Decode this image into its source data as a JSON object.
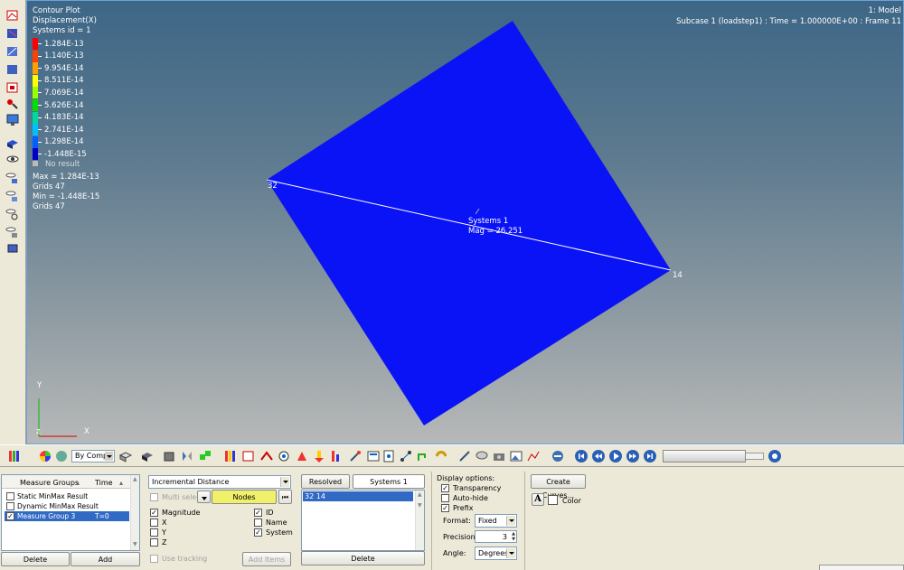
{
  "viewport": {
    "plot_title": "Contour Plot",
    "plot_result": "Displacement(X)",
    "plot_system": "Systems id = 1",
    "model_label": "1: Model",
    "subcase_label": "Subcase 1 (loadstep1) : Time = 1.000000E+00 : Frame 11",
    "legend": [
      {
        "value": "1.284E-13",
        "color": "#ff0000"
      },
      {
        "value": "1.140E-13",
        "color": "#ff4000"
      },
      {
        "value": "9.954E-14",
        "color": "#ffa000"
      },
      {
        "value": "8.511E-14",
        "color": "#ffff00"
      },
      {
        "value": "7.069E-14",
        "color": "#9cff00"
      },
      {
        "value": "5.626E-14",
        "color": "#00e000"
      },
      {
        "value": "4.183E-14",
        "color": "#00d8a0"
      },
      {
        "value": "2.741E-14",
        "color": "#00c0ff"
      },
      {
        "value": "1.298E-14",
        "color": "#0060ff"
      },
      {
        "value": "-1.448E-15",
        "color": "#0000c8"
      }
    ],
    "no_result": "No result",
    "max_label": "Max = 1.284E-13",
    "max_grids": "Grids 47",
    "min_label": "Min = -1.448E-15",
    "min_grids": "Grids 47",
    "node_a": "32",
    "node_b": "14",
    "measure_system": "Systems 1",
    "measure_mag": "Mag = 26.251",
    "axis_y": "Y",
    "axis_x": "X",
    "axis_z": "Z",
    "shape_color": "#0a13f5"
  },
  "toolbar": {
    "by_comp": "By Comp"
  },
  "measure_groups": {
    "header_groups": "Measure Groups",
    "header_time": "Time",
    "rows": [
      {
        "name": "Static MinMax Result",
        "time": "",
        "checked": false,
        "selected": false
      },
      {
        "name": "Dynamic MinMax Result",
        "time": "",
        "checked": false,
        "selected": false
      },
      {
        "name": "Measure Group 3",
        "time": "T=0",
        "checked": true,
        "selected": true
      }
    ],
    "delete_label": "Delete",
    "add_label": "Add"
  },
  "measure_type": {
    "selected": "Incremental Distance",
    "multi_select": "Multi select",
    "nodes_label": "Nodes",
    "magnitude": "Magnitude",
    "x": "X",
    "y": "Y",
    "z": "Z",
    "id": "ID",
    "name": "Name",
    "system": "System",
    "use_tracking": "Use tracking",
    "add_items": "Add Items"
  },
  "resolved": {
    "resolved_in": "Resolved in...",
    "system": "Systems 1",
    "item": "32 14",
    "delete_label": "Delete"
  },
  "display_options": {
    "title": "Display options:",
    "transparency": "Transparency",
    "auto_hide": "Auto-hide",
    "prefix": "Prefix",
    "format_label": "Format:",
    "format_value": "Fixed",
    "precision_label": "Precision:",
    "precision_value": "3",
    "angle_label": "Angle:",
    "angle_value": "Degrees"
  },
  "curves": {
    "create_curves": "Create Curves...",
    "font_glyph": "A",
    "color_label": "Color"
  }
}
